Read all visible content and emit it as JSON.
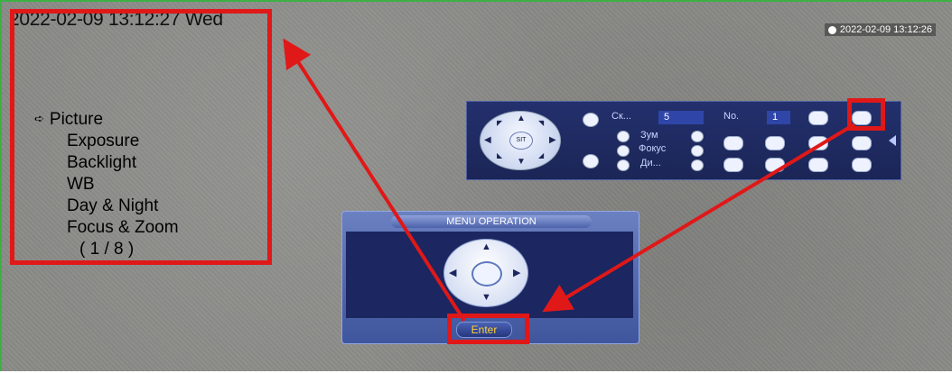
{
  "overlay": {
    "datetime": "2022-02-09 13:12:27 Wed",
    "camera_timestamp": "2022-02-09 13:12:26"
  },
  "menu": {
    "items": [
      "Picture",
      "Exposure",
      "Backlight",
      "WB",
      "Day & Night",
      "Focus & Zoom"
    ],
    "page_indicator": "( 1 / 8 )"
  },
  "ptz": {
    "center_label": "SIT",
    "speed_label": "Ск...",
    "speed_value": "5",
    "zoom_label": "Зум",
    "focus_label": "Фокус",
    "iris_label": "Ди...",
    "no_label": "No.",
    "no_value": "1"
  },
  "dialog": {
    "title": "MENU OPERATION",
    "enter_label": "Enter"
  },
  "colors": {
    "highlight": "#e01818",
    "panel": "#1b2556",
    "video_border": "#3cb043"
  }
}
